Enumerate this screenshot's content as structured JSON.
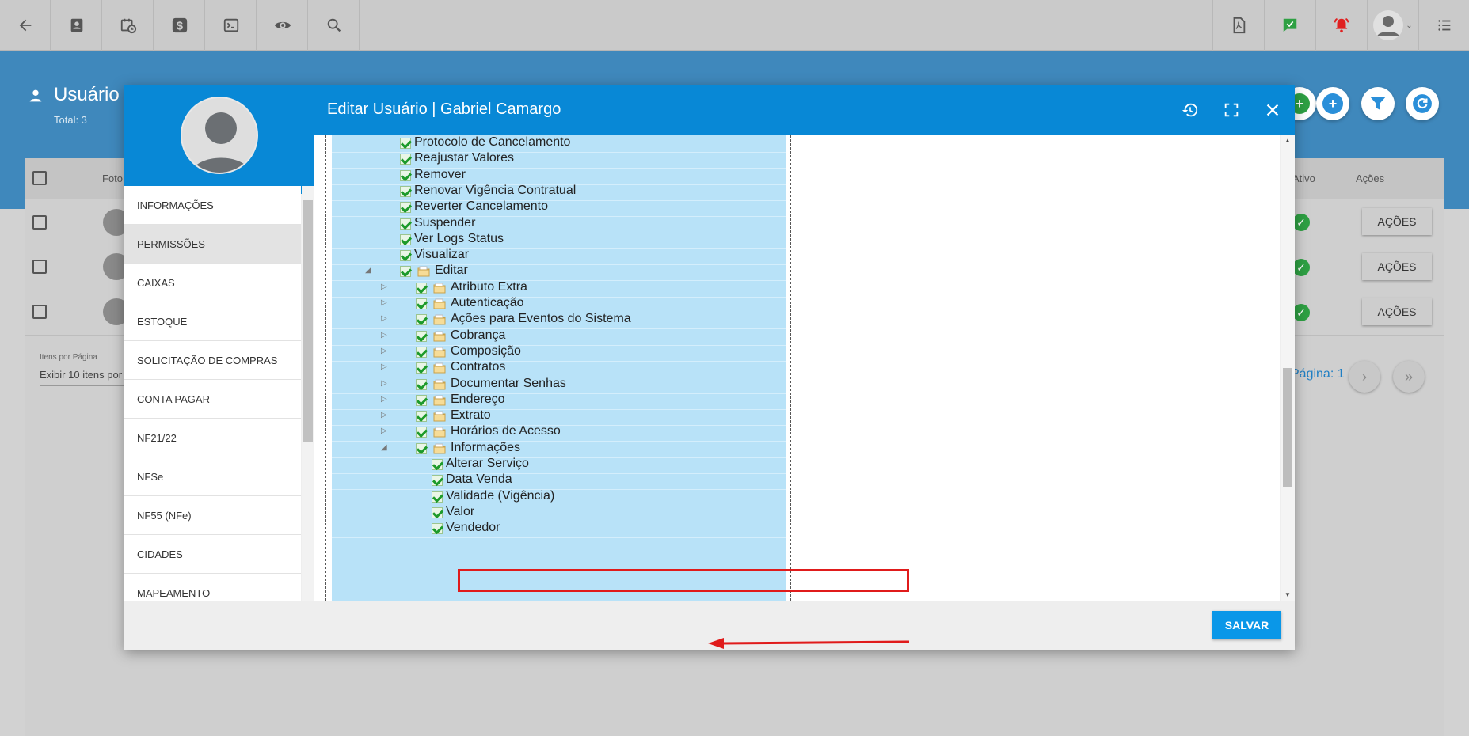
{
  "page": {
    "title": "Usuário",
    "total": "Total: 3",
    "table_headers": {
      "foto": "Foto",
      "ativo": "Ativo",
      "acoes": "Ações"
    },
    "rows": [
      {
        "action_label": "AÇÕES"
      },
      {
        "action_label": "AÇÕES"
      },
      {
        "action_label": "AÇÕES"
      }
    ],
    "items_per_page_label": "Itens por Página",
    "items_per_page_value": "Exibir 10 itens por",
    "pagination": "Página: 1"
  },
  "modal": {
    "title": "Editar Usuário | Gabriel Camargo",
    "save_label": "SALVAR",
    "sidebar": [
      {
        "label": "INFORMAÇÕES",
        "active": false
      },
      {
        "label": "PERMISSÕES",
        "active": true
      },
      {
        "label": "CAIXAS",
        "active": false
      },
      {
        "label": "ESTOQUE",
        "active": false
      },
      {
        "label": "SOLICITAÇÃO DE COMPRAS",
        "active": false
      },
      {
        "label": "CONTA PAGAR",
        "active": false
      },
      {
        "label": "NF21/22",
        "active": false
      },
      {
        "label": "NFSe",
        "active": false
      },
      {
        "label": "NF55 (NFe)",
        "active": false
      },
      {
        "label": "CIDADES",
        "active": false
      },
      {
        "label": "MAPEAMENTO",
        "active": false
      }
    ],
    "tree": [
      {
        "label": "Protocolo de Cancelamento",
        "level": 0,
        "folder": false,
        "expander": ""
      },
      {
        "label": "Reajustar Valores",
        "level": 0,
        "folder": false,
        "expander": ""
      },
      {
        "label": "Remover",
        "level": 0,
        "folder": false,
        "expander": ""
      },
      {
        "label": "Renovar Vigência Contratual",
        "level": 0,
        "folder": false,
        "expander": ""
      },
      {
        "label": "Reverter Cancelamento",
        "level": 0,
        "folder": false,
        "expander": ""
      },
      {
        "label": "Suspender",
        "level": 0,
        "folder": false,
        "expander": ""
      },
      {
        "label": "Ver Logs Status",
        "level": 0,
        "folder": false,
        "expander": ""
      },
      {
        "label": "Visualizar",
        "level": 0,
        "folder": false,
        "expander": ""
      },
      {
        "label": "Editar",
        "level": 0,
        "folder": true,
        "expander": "expanded"
      },
      {
        "label": "Atributo Extra",
        "level": 1,
        "folder": true,
        "expander": "collapsed"
      },
      {
        "label": "Autenticação",
        "level": 1,
        "folder": true,
        "expander": "collapsed"
      },
      {
        "label": "Ações para Eventos do Sistema",
        "level": 1,
        "folder": true,
        "expander": "collapsed"
      },
      {
        "label": "Cobrança",
        "level": 1,
        "folder": true,
        "expander": "collapsed"
      },
      {
        "label": "Composição",
        "level": 1,
        "folder": true,
        "expander": "collapsed"
      },
      {
        "label": "Contratos",
        "level": 1,
        "folder": true,
        "expander": "collapsed"
      },
      {
        "label": "Documentar Senhas",
        "level": 1,
        "folder": true,
        "expander": "collapsed"
      },
      {
        "label": "Endereço",
        "level": 1,
        "folder": true,
        "expander": "collapsed"
      },
      {
        "label": "Extrato",
        "level": 1,
        "folder": true,
        "expander": "collapsed"
      },
      {
        "label": "Horários de Acesso",
        "level": 1,
        "folder": true,
        "expander": "collapsed"
      },
      {
        "label": "Informações",
        "level": 1,
        "folder": true,
        "expander": "expanded",
        "highlighted": true
      },
      {
        "label": "Alterar Serviço",
        "level": 2,
        "folder": false,
        "expander": ""
      },
      {
        "label": "Data Venda",
        "level": 2,
        "folder": false,
        "expander": ""
      },
      {
        "label": "Validade (Vigência)",
        "level": 2,
        "folder": false,
        "expander": "",
        "arrow": true
      },
      {
        "label": "Valor",
        "level": 2,
        "folder": false,
        "expander": ""
      },
      {
        "label": "Vendedor",
        "level": 2,
        "folder": false,
        "expander": ""
      }
    ]
  },
  "icons": {
    "toolbar_left": [
      "back-arrow-icon",
      "contact-card-icon",
      "calendar-clock-icon",
      "dollar-icon",
      "terminal-icon",
      "eye-icon",
      "search-icon"
    ],
    "toolbar_right": [
      "pdf-icon",
      "chat-check-icon",
      "alarm-bell-icon",
      "user-avatar-icon",
      "list-menu-icon"
    ],
    "modal_header": [
      "history-icon",
      "fullscreen-icon",
      "close-icon"
    ]
  },
  "colors": {
    "modal_header": "#0888d6",
    "band": "#3f88bc",
    "tree_row": "#b8e2f8",
    "highlight": "#e01b1b",
    "save_button": "#0a97e8",
    "success": "#2ea043",
    "alarm": "#e02020"
  }
}
